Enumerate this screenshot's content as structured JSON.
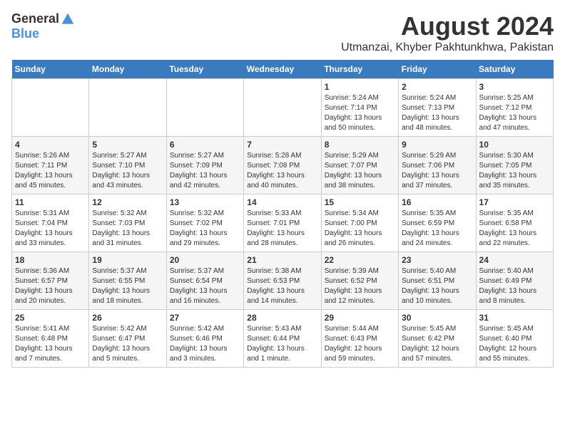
{
  "logo": {
    "general": "General",
    "blue": "Blue"
  },
  "title": "August 2024",
  "subtitle": "Utmanzai, Khyber Pakhtunkhwa, Pakistan",
  "headers": [
    "Sunday",
    "Monday",
    "Tuesday",
    "Wednesday",
    "Thursday",
    "Friday",
    "Saturday"
  ],
  "weeks": [
    [
      {
        "day": "",
        "info": ""
      },
      {
        "day": "",
        "info": ""
      },
      {
        "day": "",
        "info": ""
      },
      {
        "day": "",
        "info": ""
      },
      {
        "day": "1",
        "info": "Sunrise: 5:24 AM\nSunset: 7:14 PM\nDaylight: 13 hours\nand 50 minutes."
      },
      {
        "day": "2",
        "info": "Sunrise: 5:24 AM\nSunset: 7:13 PM\nDaylight: 13 hours\nand 48 minutes."
      },
      {
        "day": "3",
        "info": "Sunrise: 5:25 AM\nSunset: 7:12 PM\nDaylight: 13 hours\nand 47 minutes."
      }
    ],
    [
      {
        "day": "4",
        "info": "Sunrise: 5:26 AM\nSunset: 7:11 PM\nDaylight: 13 hours\nand 45 minutes."
      },
      {
        "day": "5",
        "info": "Sunrise: 5:27 AM\nSunset: 7:10 PM\nDaylight: 13 hours\nand 43 minutes."
      },
      {
        "day": "6",
        "info": "Sunrise: 5:27 AM\nSunset: 7:09 PM\nDaylight: 13 hours\nand 42 minutes."
      },
      {
        "day": "7",
        "info": "Sunrise: 5:28 AM\nSunset: 7:08 PM\nDaylight: 13 hours\nand 40 minutes."
      },
      {
        "day": "8",
        "info": "Sunrise: 5:29 AM\nSunset: 7:07 PM\nDaylight: 13 hours\nand 38 minutes."
      },
      {
        "day": "9",
        "info": "Sunrise: 5:29 AM\nSunset: 7:06 PM\nDaylight: 13 hours\nand 37 minutes."
      },
      {
        "day": "10",
        "info": "Sunrise: 5:30 AM\nSunset: 7:05 PM\nDaylight: 13 hours\nand 35 minutes."
      }
    ],
    [
      {
        "day": "11",
        "info": "Sunrise: 5:31 AM\nSunset: 7:04 PM\nDaylight: 13 hours\nand 33 minutes."
      },
      {
        "day": "12",
        "info": "Sunrise: 5:32 AM\nSunset: 7:03 PM\nDaylight: 13 hours\nand 31 minutes."
      },
      {
        "day": "13",
        "info": "Sunrise: 5:32 AM\nSunset: 7:02 PM\nDaylight: 13 hours\nand 29 minutes."
      },
      {
        "day": "14",
        "info": "Sunrise: 5:33 AM\nSunset: 7:01 PM\nDaylight: 13 hours\nand 28 minutes."
      },
      {
        "day": "15",
        "info": "Sunrise: 5:34 AM\nSunset: 7:00 PM\nDaylight: 13 hours\nand 26 minutes."
      },
      {
        "day": "16",
        "info": "Sunrise: 5:35 AM\nSunset: 6:59 PM\nDaylight: 13 hours\nand 24 minutes."
      },
      {
        "day": "17",
        "info": "Sunrise: 5:35 AM\nSunset: 6:58 PM\nDaylight: 13 hours\nand 22 minutes."
      }
    ],
    [
      {
        "day": "18",
        "info": "Sunrise: 5:36 AM\nSunset: 6:57 PM\nDaylight: 13 hours\nand 20 minutes."
      },
      {
        "day": "19",
        "info": "Sunrise: 5:37 AM\nSunset: 6:55 PM\nDaylight: 13 hours\nand 18 minutes."
      },
      {
        "day": "20",
        "info": "Sunrise: 5:37 AM\nSunset: 6:54 PM\nDaylight: 13 hours\nand 16 minutes."
      },
      {
        "day": "21",
        "info": "Sunrise: 5:38 AM\nSunset: 6:53 PM\nDaylight: 13 hours\nand 14 minutes."
      },
      {
        "day": "22",
        "info": "Sunrise: 5:39 AM\nSunset: 6:52 PM\nDaylight: 13 hours\nand 12 minutes."
      },
      {
        "day": "23",
        "info": "Sunrise: 5:40 AM\nSunset: 6:51 PM\nDaylight: 13 hours\nand 10 minutes."
      },
      {
        "day": "24",
        "info": "Sunrise: 5:40 AM\nSunset: 6:49 PM\nDaylight: 13 hours\nand 8 minutes."
      }
    ],
    [
      {
        "day": "25",
        "info": "Sunrise: 5:41 AM\nSunset: 6:48 PM\nDaylight: 13 hours\nand 7 minutes."
      },
      {
        "day": "26",
        "info": "Sunrise: 5:42 AM\nSunset: 6:47 PM\nDaylight: 13 hours\nand 5 minutes."
      },
      {
        "day": "27",
        "info": "Sunrise: 5:42 AM\nSunset: 6:46 PM\nDaylight: 13 hours\nand 3 minutes."
      },
      {
        "day": "28",
        "info": "Sunrise: 5:43 AM\nSunset: 6:44 PM\nDaylight: 13 hours\nand 1 minute."
      },
      {
        "day": "29",
        "info": "Sunrise: 5:44 AM\nSunset: 6:43 PM\nDaylight: 12 hours\nand 59 minutes."
      },
      {
        "day": "30",
        "info": "Sunrise: 5:45 AM\nSunset: 6:42 PM\nDaylight: 12 hours\nand 57 minutes."
      },
      {
        "day": "31",
        "info": "Sunrise: 5:45 AM\nSunset: 6:40 PM\nDaylight: 12 hours\nand 55 minutes."
      }
    ]
  ]
}
